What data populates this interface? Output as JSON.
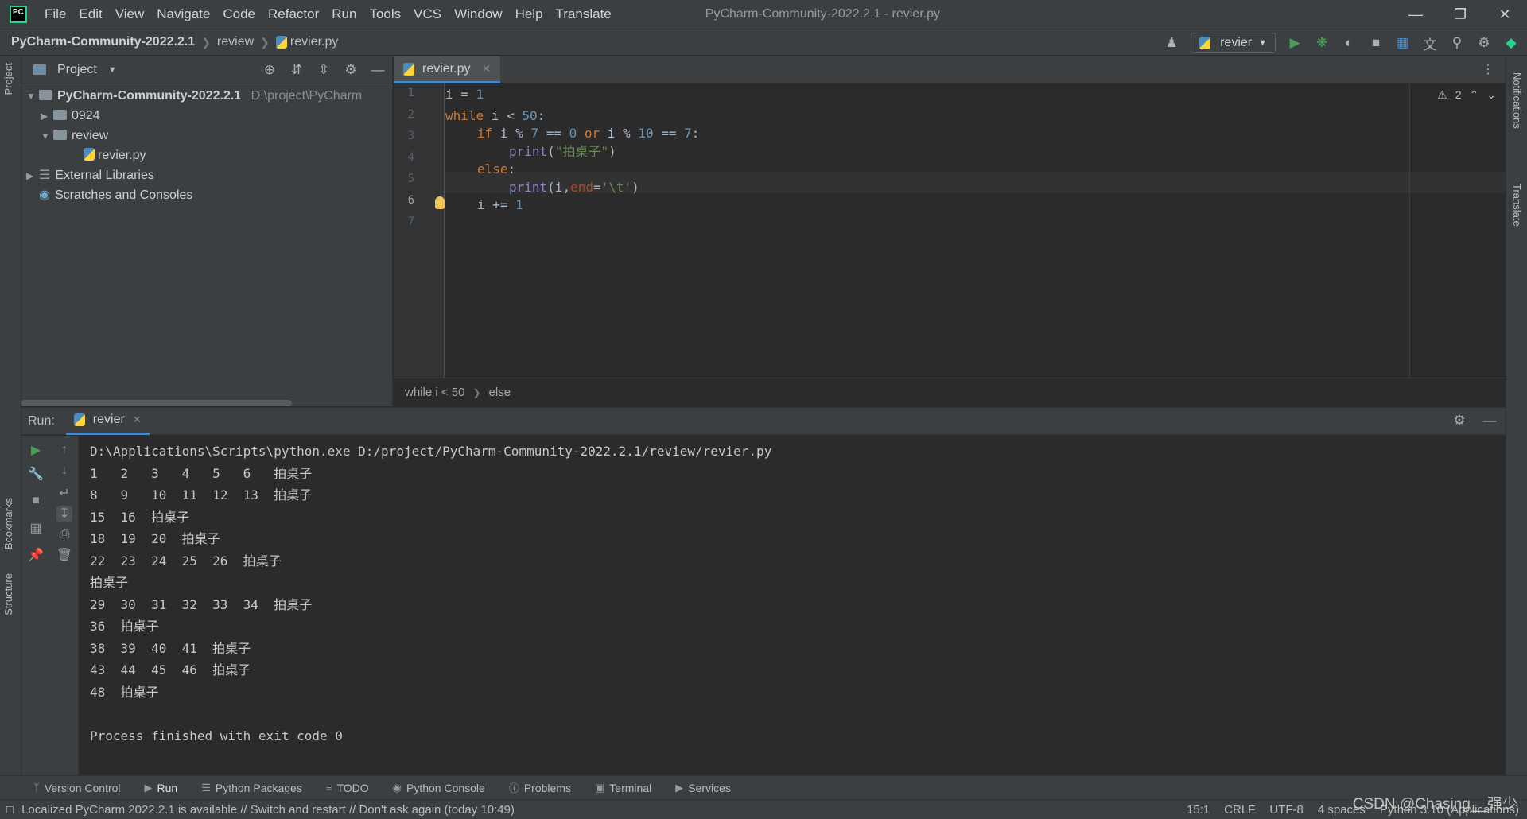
{
  "menubar": {
    "items": [
      "File",
      "Edit",
      "View",
      "Navigate",
      "Code",
      "Refactor",
      "Run",
      "Tools",
      "VCS",
      "Window",
      "Help",
      "Translate"
    ],
    "window_title": "PyCharm-Community-2022.2.1 - revier.py"
  },
  "navbar": {
    "project": "PyCharm-Community-2022.2.1",
    "folder": "review",
    "file": "revier.py",
    "run_config": "revier"
  },
  "left_strip": {
    "project": "Project",
    "bookmarks": "Bookmarks",
    "structure": "Structure"
  },
  "right_strip": {
    "notifications": "Notifications",
    "translate": "Translate"
  },
  "project_panel": {
    "title": "Project",
    "root_name": "PyCharm-Community-2022.2.1",
    "root_path": "D:\\project\\PyCharm",
    "folder_0924": "0924",
    "folder_review": "review",
    "file_revier": "revier.py",
    "external_libraries": "External Libraries",
    "scratches": "Scratches and Consoles"
  },
  "editor": {
    "tab_label": "revier.py",
    "line_numbers": [
      "1",
      "2",
      "3",
      "4",
      "5",
      "6",
      "7"
    ],
    "inspection_count": "2",
    "breadcrumb": [
      "while i < 50",
      "else"
    ]
  },
  "run_panel": {
    "label": "Run:",
    "tab": "revier",
    "console": [
      "D:\\Applications\\Scripts\\python.exe D:/project/PyCharm-Community-2022.2.1/review/revier.py",
      "1\t2\t3\t4\t5\t6\t拍桌子",
      "8\t9\t10\t11\t12\t13\t拍桌子",
      "15\t16\t拍桌子",
      "18\t19\t20\t拍桌子",
      "22\t23\t24\t25\t26\t拍桌子",
      "拍桌子",
      "29\t30\t31\t32\t33\t34\t拍桌子",
      "36\t拍桌子",
      "38\t39\t40\t41\t拍桌子",
      "43\t44\t45\t46\t拍桌子",
      "48\t拍桌子",
      "",
      "Process finished with exit code 0"
    ]
  },
  "bottom_bar": {
    "version_control": "Version Control",
    "run": "Run",
    "python_packages": "Python Packages",
    "todo": "TODO",
    "python_console": "Python Console",
    "problems": "Problems",
    "terminal": "Terminal",
    "services": "Services"
  },
  "status_bar": {
    "message": "Localized PyCharm 2022.2.1 is available // Switch and restart // Don't ask again (today 10:49)",
    "position": "15:1",
    "line_sep": "CRLF",
    "encoding": "UTF-8",
    "indent": "4 spaces",
    "interpreter": "Python 3.10 (Applications)"
  },
  "watermark": "CSDN @Chasing__强少",
  "colors": {
    "accent": "#4a88c7",
    "run_green": "#499c54",
    "keyword": "#cc7832",
    "number": "#6897bb",
    "string": "#6a8759"
  }
}
